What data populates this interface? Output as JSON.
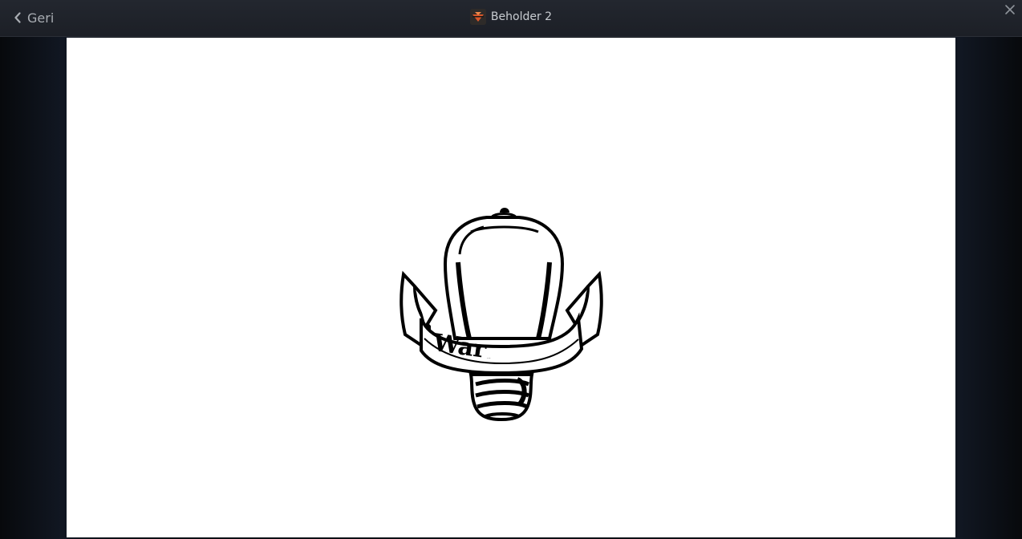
{
  "topbar": {
    "back_label": "Geri",
    "title": "Beholder 2",
    "back_icon": "chevron-left-icon",
    "close_icon": "close-icon",
    "app_icon": "beholder-app-icon"
  },
  "image": {
    "banner_text": "War",
    "banner_small_text": "..."
  },
  "colors": {
    "topbar_bg": "#1f2229",
    "viewer_bg": "#0b0f15",
    "canvas_bg": "#ffffff",
    "text": "#c8ccd1",
    "app_icon_accent": "#d9572a"
  }
}
